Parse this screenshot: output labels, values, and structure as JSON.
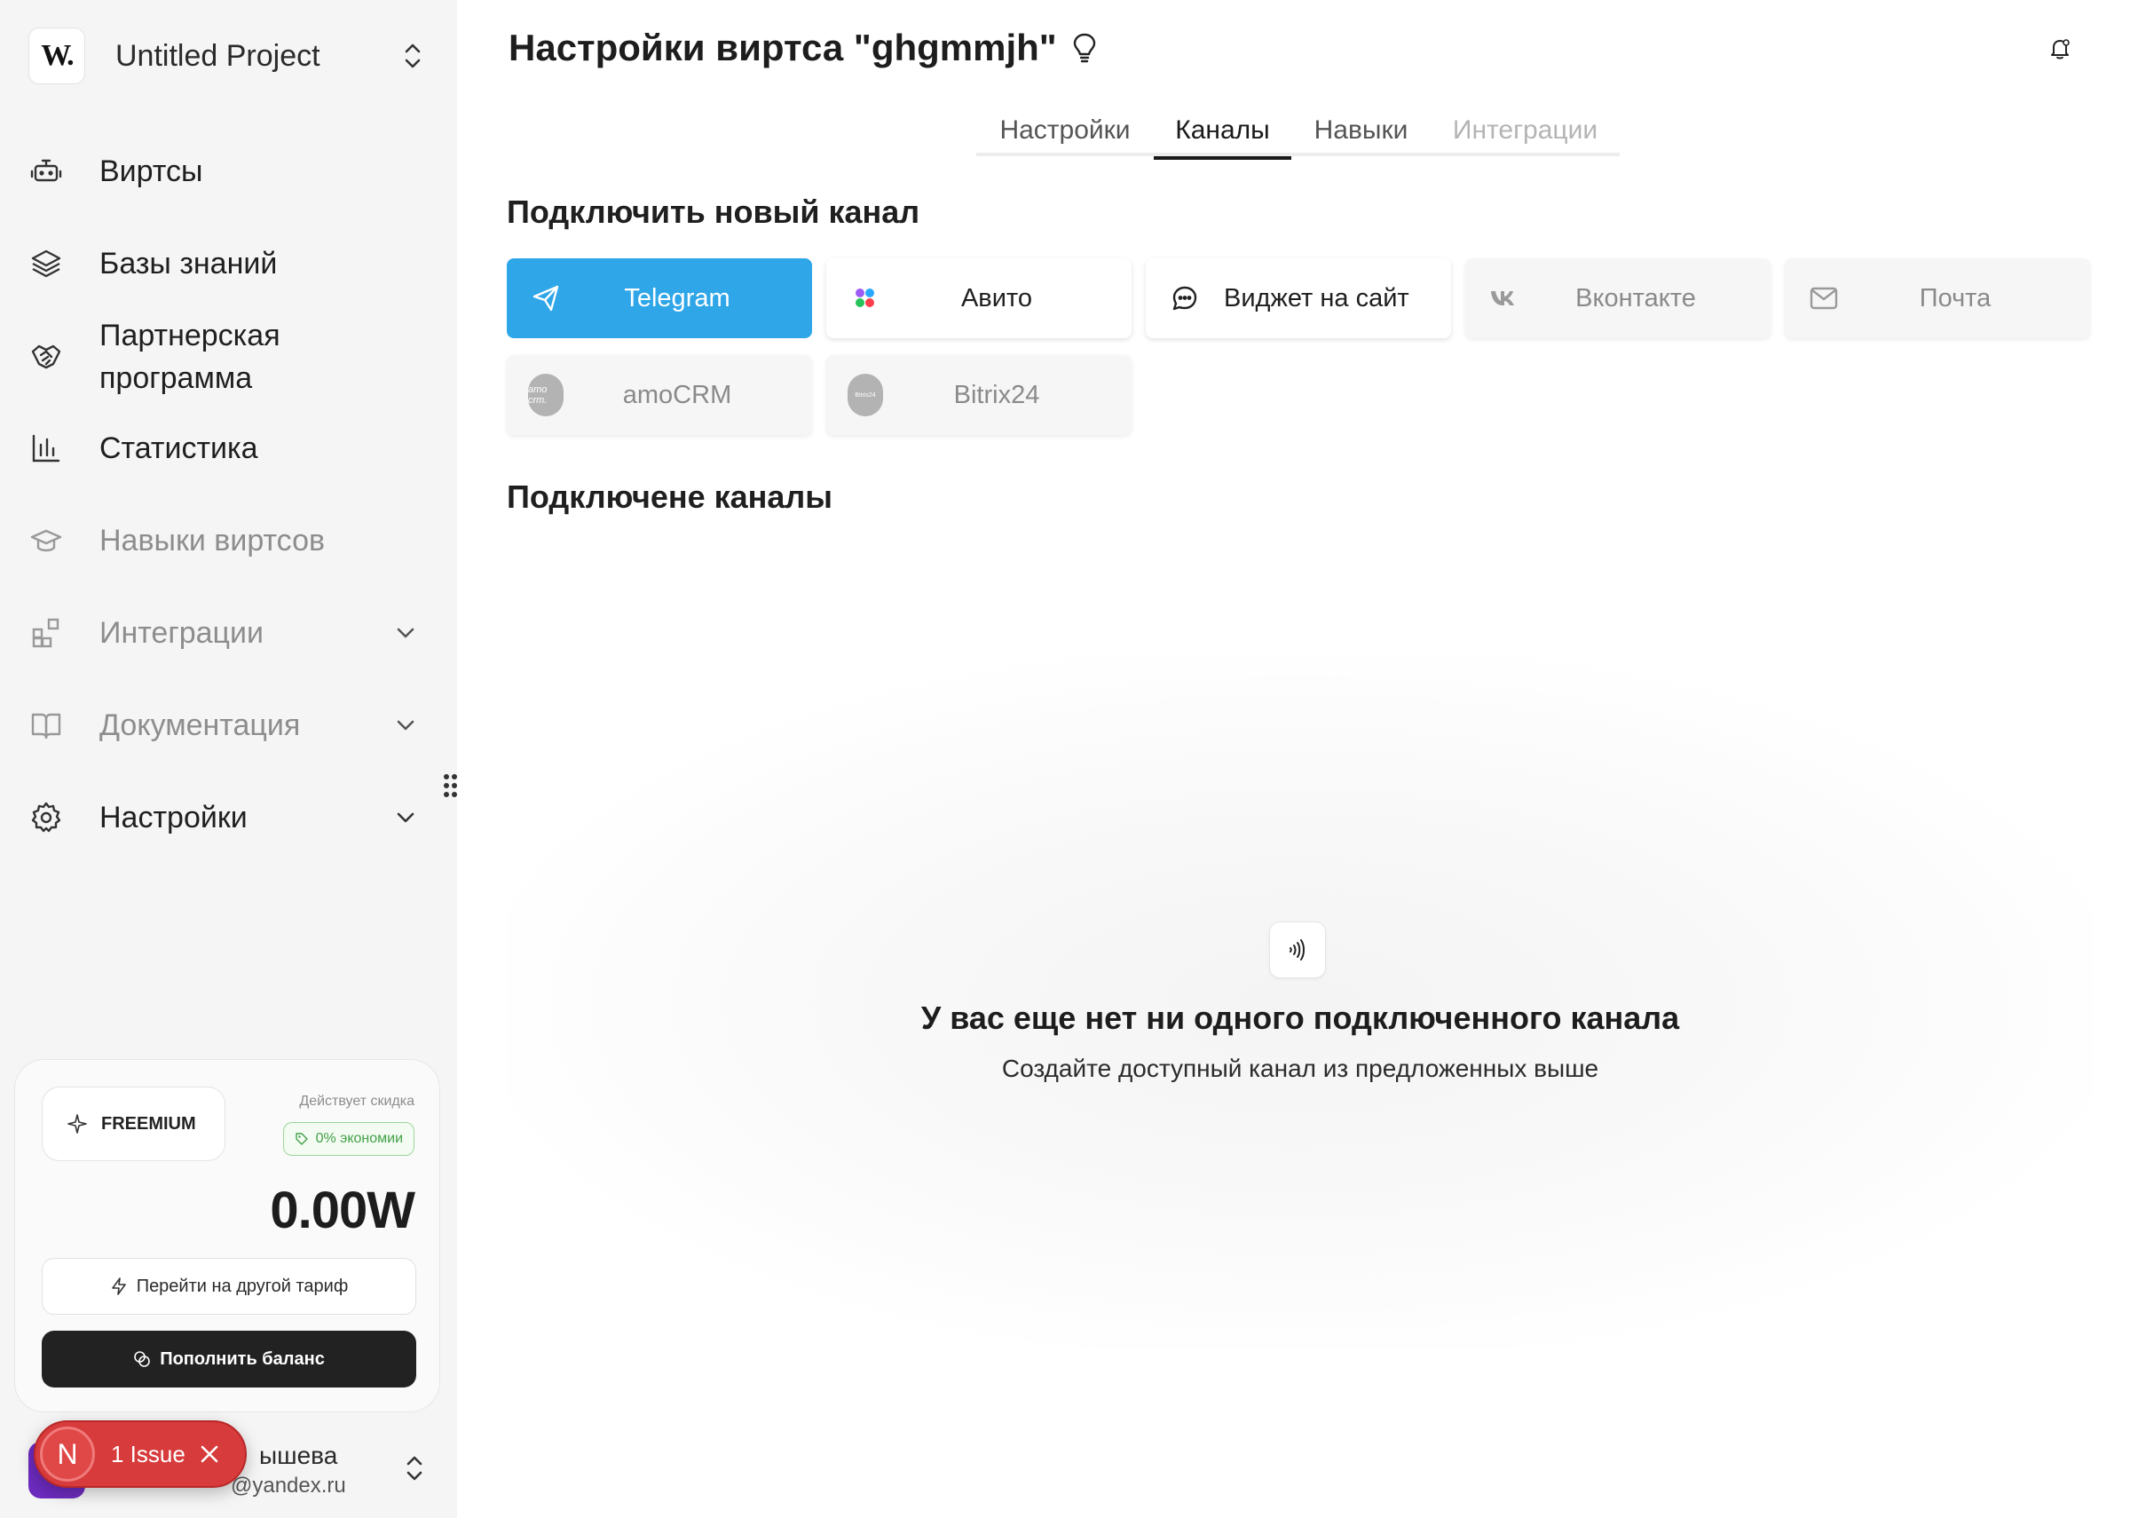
{
  "project": {
    "logo": "W.",
    "name": "Untitled Project"
  },
  "sidebar": {
    "items": [
      {
        "label": "Виртсы",
        "icon": "robot-icon",
        "dim": false,
        "expandable": false
      },
      {
        "label": "Базы знаний",
        "icon": "layers-icon",
        "dim": false,
        "expandable": false
      },
      {
        "label": "Партнерская программа",
        "icon": "handshake-icon",
        "dim": false,
        "expandable": false
      },
      {
        "label": "Статистика",
        "icon": "bar-chart-icon",
        "dim": false,
        "expandable": false
      },
      {
        "label": "Навыки виртсов",
        "icon": "graduation-cap-icon",
        "dim": true,
        "expandable": false
      },
      {
        "label": "Интеграции",
        "icon": "blocks-icon",
        "dim": true,
        "expandable": true
      },
      {
        "label": "Документация",
        "icon": "book-icon",
        "dim": true,
        "expandable": true
      },
      {
        "label": "Настройки",
        "icon": "gear-icon",
        "dim": false,
        "expandable": true
      }
    ]
  },
  "plan": {
    "badge": "FREEMIUM",
    "discount_label": "Действует скидка",
    "discount_value": "0% экономии",
    "balance": "0.00W",
    "switch_label": "Перейти на другой тариф",
    "topup_label": "Пополнить баланс"
  },
  "user": {
    "name_fragment": "ышева",
    "email_fragment": "@yandex.ru"
  },
  "issue_badge": {
    "letter": "N",
    "text": "1 Issue"
  },
  "header": {
    "title": "Настройки виртса \"ghgmmjh\""
  },
  "tabs": [
    {
      "label": "Настройки",
      "state": "normal"
    },
    {
      "label": "Каналы",
      "state": "active"
    },
    {
      "label": "Навыки",
      "state": "normal"
    },
    {
      "label": "Интеграции",
      "state": "disabled"
    }
  ],
  "connect_heading": "Подключить новый канал",
  "channels": [
    {
      "label": "Telegram",
      "icon": "telegram-icon",
      "state": "selected"
    },
    {
      "label": "Авито",
      "icon": "avito-icon",
      "state": "enabled"
    },
    {
      "label": "Виджет на сайт",
      "icon": "chat-bubble-icon",
      "state": "enabled"
    },
    {
      "label": "Вконтакте",
      "icon": "vk-icon",
      "state": "disabled"
    },
    {
      "label": "Почта",
      "icon": "mail-icon",
      "state": "disabled"
    },
    {
      "label": "amoCRM",
      "icon": "amocrm-icon",
      "icon_text": "amo crm.",
      "state": "disabled"
    },
    {
      "label": "Bitrix24",
      "icon": "bitrix24-icon",
      "icon_text": "Bitrix24",
      "state": "disabled"
    }
  ],
  "connected_heading": "Подключене каналы",
  "empty_state": {
    "icon": "signal-waves-icon",
    "title": "У вас еще нет ни одного подключенного канала",
    "subtitle": "Создайте доступный канал из предложенных выше"
  },
  "colors": {
    "telegram": "#2ea6e8",
    "topup_button": "#222222",
    "issue_badge": "#d73b3b",
    "discount": "#43a047"
  }
}
